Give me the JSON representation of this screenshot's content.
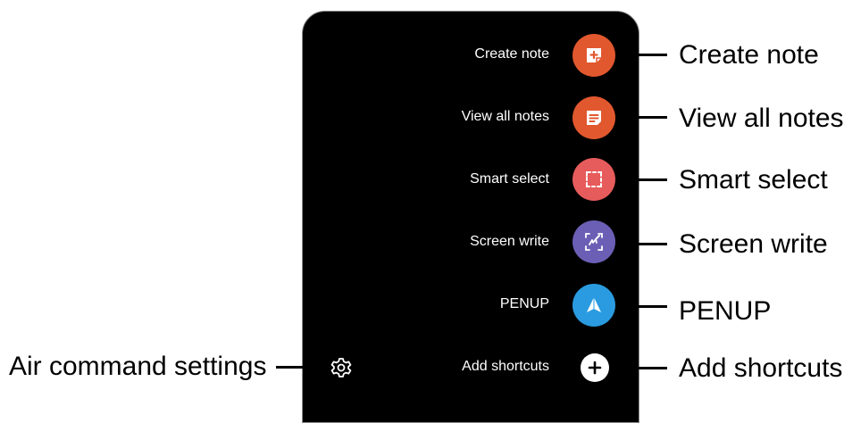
{
  "menu": {
    "items": [
      {
        "label": "Create note",
        "callout": "Create note",
        "icon": "create-note-icon",
        "color": "#E2582E"
      },
      {
        "label": "View all notes",
        "callout": "View all notes",
        "icon": "view-notes-icon",
        "color": "#E2582E"
      },
      {
        "label": "Smart select",
        "callout": "Smart select",
        "icon": "smart-select-icon",
        "color": "#E65B5B"
      },
      {
        "label": "Screen write",
        "callout": "Screen write",
        "icon": "screen-write-icon",
        "color": "#6B5FB5"
      },
      {
        "label": "PENUP",
        "callout": "PENUP",
        "icon": "penup-icon",
        "color": "#2A9BE0"
      },
      {
        "label": "Add shortcuts",
        "callout": "Add shortcuts",
        "icon": "plus-icon",
        "color": "#FFFFFF"
      }
    ]
  },
  "settings": {
    "callout": "Air command settings",
    "icon": "gear-icon"
  }
}
